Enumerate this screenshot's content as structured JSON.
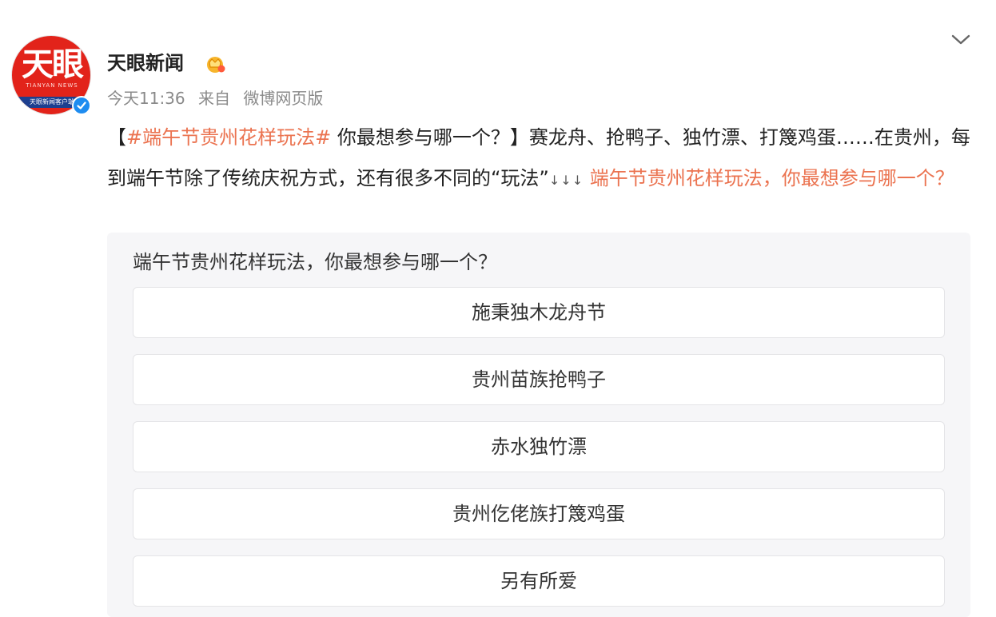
{
  "author": {
    "name": "天眼新闻",
    "avatar_logo": "天眼",
    "avatar_subtext": "TIANYAN NEWS",
    "avatar_band": "天眼新闻客户端"
  },
  "meta": {
    "time": "今天11:36",
    "from": "来自",
    "source": "微博网页版"
  },
  "post": {
    "bracket_open": "【",
    "topic_tag": "#端午节贵州花样玩法#",
    "question": " 你最想参与哪一个？",
    "bracket_close": "】",
    "body": "赛龙舟、抢鸭子、独竹漂、打篾鸡蛋……在贵州，每到端午节除了传统庆祝方式，还有很多不同的“玩法”",
    "arrows": "↓↓↓",
    "poll_link": " 端午节贵州花样玩法，你最想参与哪一个？"
  },
  "poll": {
    "title": "端午节贵州花样玩法，你最想参与哪一个？",
    "options": [
      "施秉独木龙舟节",
      "贵州苗族抢鸭子",
      "赤水独竹漂",
      "贵州仡佬族打篾鸡蛋",
      "另有所爱"
    ]
  },
  "colors": {
    "topic": "#eb7350",
    "avatar_red": "#e2231a",
    "verified_blue": "#1e8cf0",
    "poll_background": "#f6f6f8"
  },
  "icons": {
    "verified": "verified-icon",
    "crown": "crown-icon",
    "menu": "chevron-down-icon"
  }
}
